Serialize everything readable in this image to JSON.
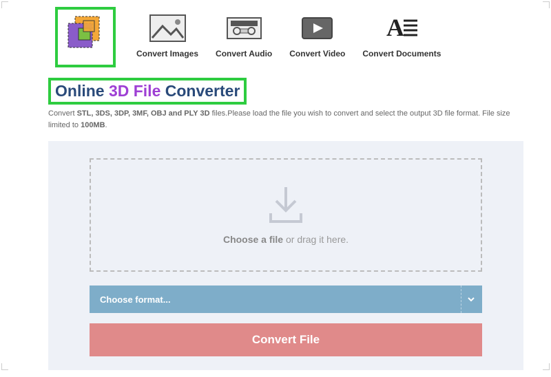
{
  "nav": {
    "items": [
      {
        "label": "Convert Images"
      },
      {
        "label": "Convert Audio"
      },
      {
        "label": "Convert Video"
      },
      {
        "label": "Convert Documents"
      }
    ]
  },
  "title": {
    "part1": "Online ",
    "part2": "3D File",
    "part3": " Converter"
  },
  "desc": {
    "pre": "Convert ",
    "formats": "STL, 3DS, 3DP, 3MF, OBJ and PLY 3D",
    "mid": " files.Please load the file you wish to convert and select the output 3D file format. File size limited to ",
    "limit": "100MB",
    "post": "."
  },
  "dropzone": {
    "bold": "Choose a file",
    "rest": " or drag it here."
  },
  "format_select": {
    "placeholder": "Choose format..."
  },
  "convert_button": {
    "label": "Convert File"
  }
}
